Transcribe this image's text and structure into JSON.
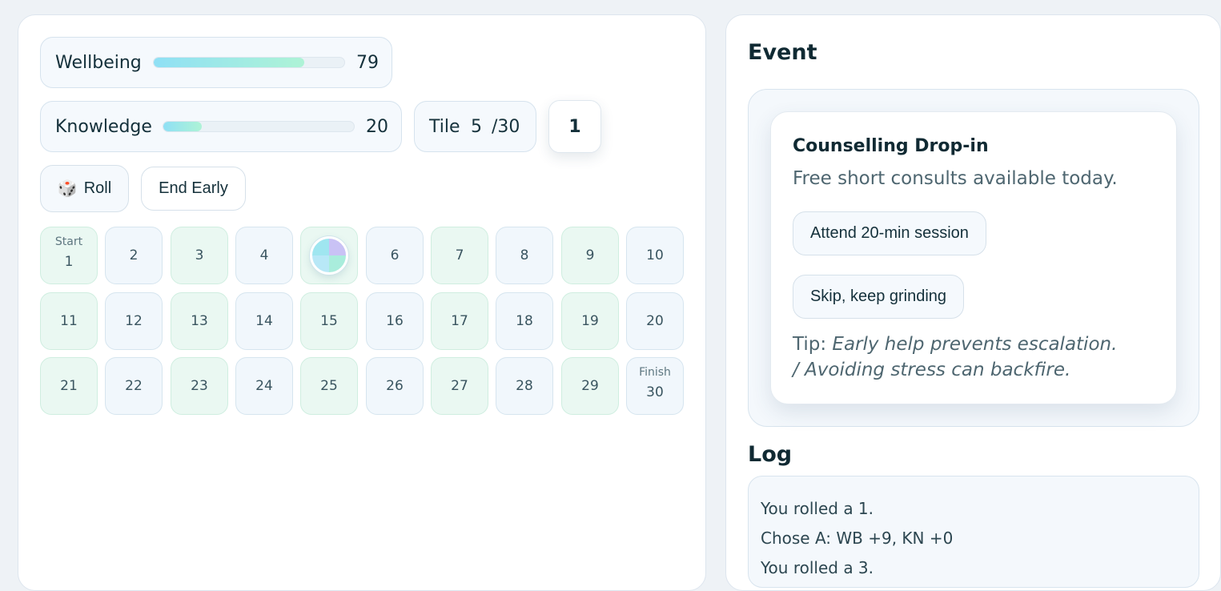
{
  "stats": {
    "wellbeing": {
      "label": "Wellbeing",
      "value": "79",
      "level": 0.79
    },
    "knowledge": {
      "label": "Knowledge",
      "value": "20",
      "level": 0.2
    }
  },
  "tile": {
    "label": "Tile",
    "current": "5",
    "total": "/30"
  },
  "die": {
    "value": "1"
  },
  "controls": {
    "roll_icon": "🎲",
    "roll_label": "Roll",
    "end_early_label": "End Early"
  },
  "board": {
    "start_label": "Start",
    "finish_label": "Finish",
    "player_tile": 5,
    "tiles": [
      "1",
      "2",
      "3",
      "4",
      "5",
      "6",
      "7",
      "8",
      "9",
      "10",
      "11",
      "12",
      "13",
      "14",
      "15",
      "16",
      "17",
      "18",
      "19",
      "20",
      "21",
      "22",
      "23",
      "24",
      "25",
      "26",
      "27",
      "28",
      "29",
      "30"
    ]
  },
  "event": {
    "heading": "Event",
    "title": "Counselling Drop-in",
    "description": "Free short consults available today.",
    "choice_a": "Attend 20-min session",
    "choice_b": "Skip, keep grinding",
    "tip_label": "Tip: ",
    "tip_text": "Early help prevents escalation. / Avoiding stress can backfire."
  },
  "log": {
    "heading": "Log",
    "entries": [
      "You rolled a 1.",
      "Chose A: WB +9, KN +0",
      "You rolled a 3."
    ]
  }
}
